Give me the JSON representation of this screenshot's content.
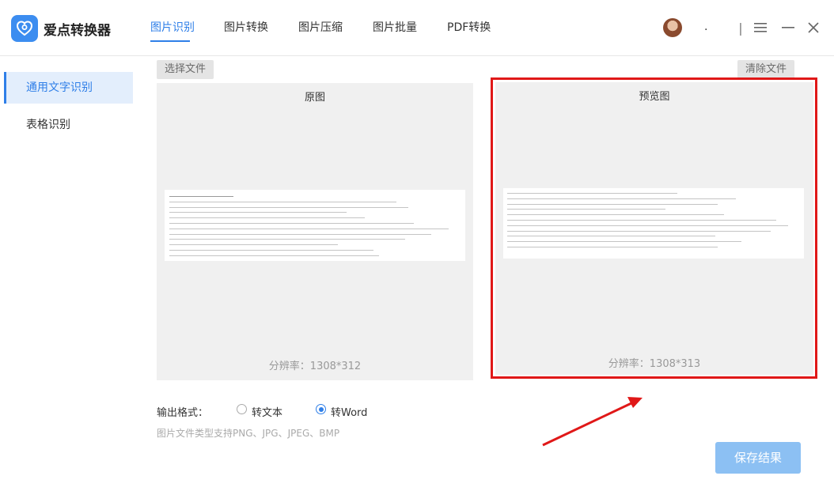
{
  "app": {
    "title": "爱点转换器"
  },
  "nav": {
    "tabs": [
      "图片识别",
      "图片转换",
      "图片压缩",
      "图片批量",
      "PDF转换"
    ],
    "active": 0
  },
  "header": {
    "user_dot": "."
  },
  "window_controls": [
    "menu-icon",
    "minimize-icon",
    "close-icon"
  ],
  "sidebar": {
    "items": [
      {
        "label": "通用文字识别",
        "active": true
      },
      {
        "label": "表格识别",
        "active": false
      }
    ]
  },
  "toolbar": {
    "select_file": "选择文件",
    "clear_file": "清除文件"
  },
  "original_panel": {
    "title": "原图",
    "resolution": "分辨率：1308*312"
  },
  "preview_panel": {
    "title": "预览图",
    "resolution": "分辨率：1308*313"
  },
  "output": {
    "label": "输出格式：",
    "options": [
      {
        "label": "转文本",
        "selected": false
      },
      {
        "label": "转Word",
        "selected": true
      }
    ]
  },
  "support_text": "图片文件类型支持PNG、JPG、JPEG、BMP",
  "save_button": "保存结果",
  "colors": {
    "accent": "#2f7fe8",
    "highlight_box": "#e01818",
    "save_button": "#8cc0f3"
  }
}
